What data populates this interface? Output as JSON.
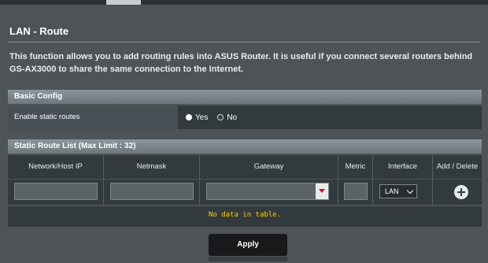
{
  "page_title": "LAN - Route",
  "description": "This function allows you to add routing rules into ASUS Router. It is useful if you connect several routers behind GS-AX3000 to share the same connection to the Internet.",
  "basic_config": {
    "header": "Basic Config",
    "enable_static_routes_label": "Enable static routes",
    "options": {
      "yes": "Yes",
      "no": "No"
    },
    "selected": "yes"
  },
  "route_list": {
    "header": "Static Route List (Max Limit : 32)",
    "columns": [
      "Network/Host IP",
      "Netmask",
      "Gateway",
      "Metric",
      "Interface",
      "Add / Delete"
    ],
    "inputs": {
      "network_value": "",
      "netmask_value": "",
      "gateway_value": "",
      "metric_value": ""
    },
    "interface_selected": "LAN",
    "empty_message": "No data in table."
  },
  "apply_label": "Apply",
  "icons": {
    "add": "plus-circle-icon",
    "dropdown": "triangle-down-icon",
    "select": "chevron-down-icon"
  },
  "colors": {
    "background": "#4d5356",
    "panel": "#333a3e",
    "header_bar": "#7a858b",
    "empty_text": "#ffcc00",
    "apply_button": "#17191a"
  }
}
